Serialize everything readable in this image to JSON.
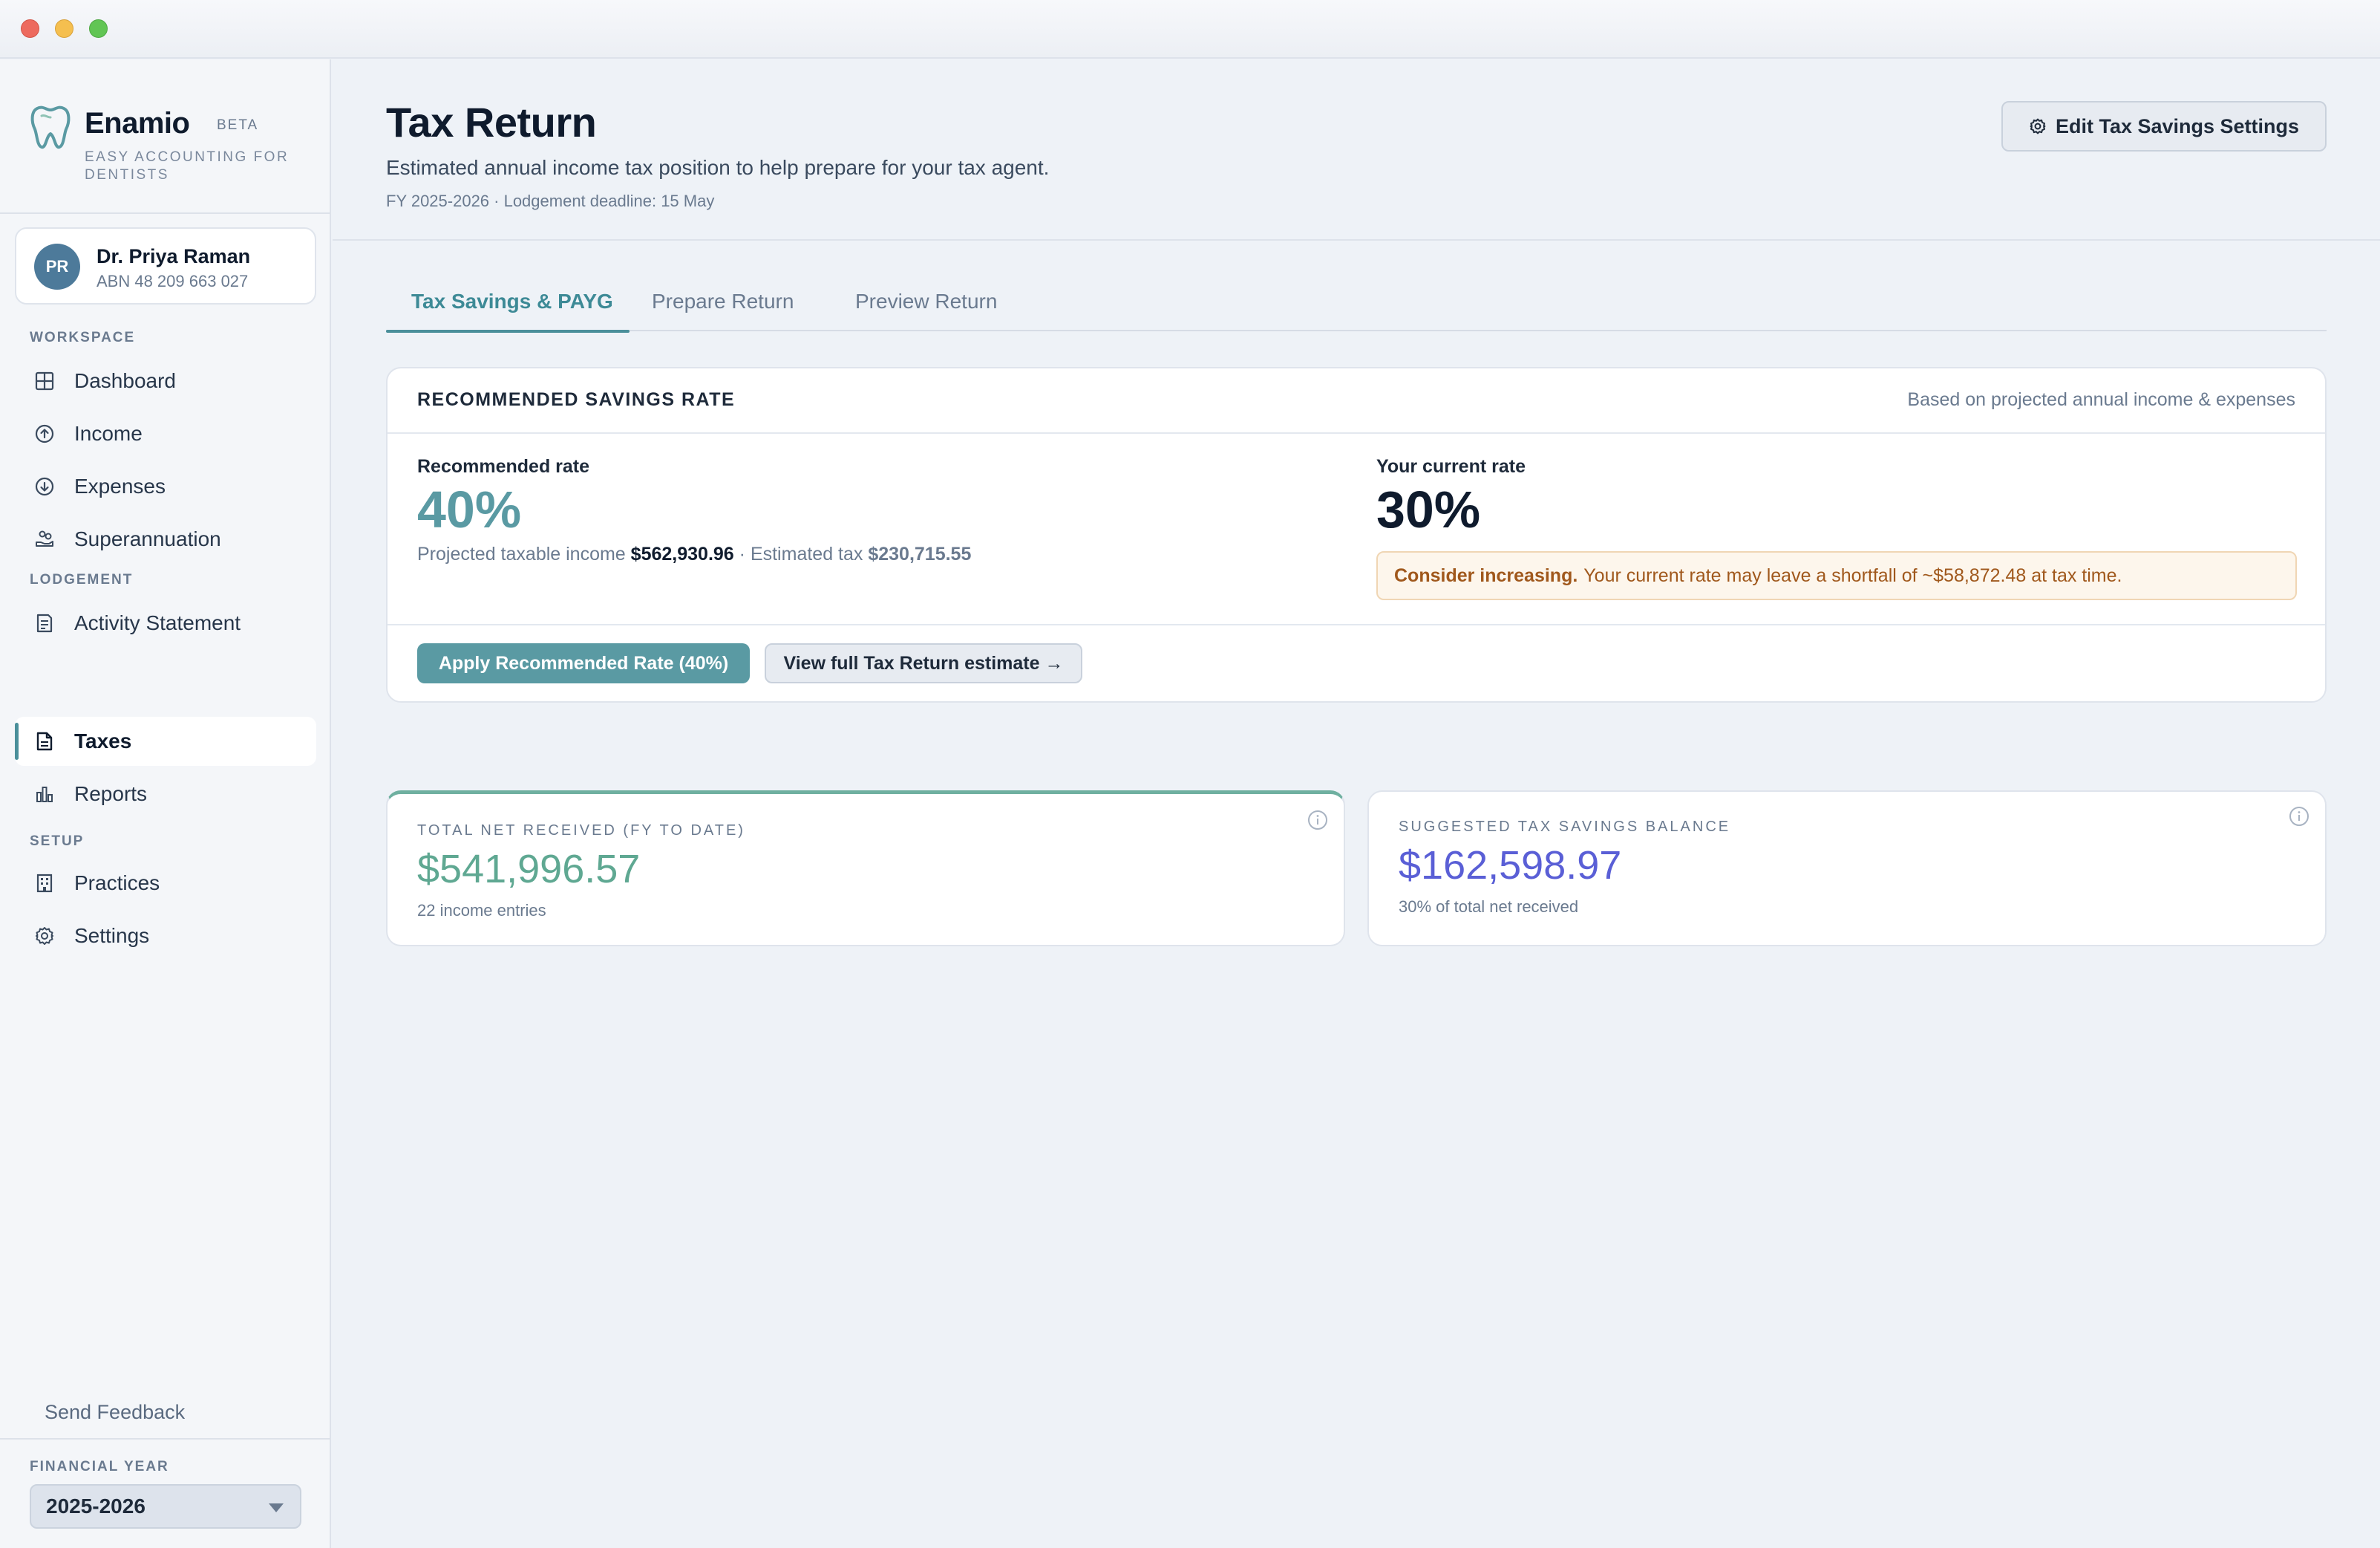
{
  "app": {
    "name": "Enamio",
    "badge": "BETA",
    "tagline": "EASY ACCOUNTING FOR DENTISTS"
  },
  "user": {
    "initials": "PR",
    "name": "Dr. Priya Raman",
    "abn": "ABN 48 209 663 027"
  },
  "sidebar": {
    "sections": [
      "WORKSPACE",
      "LODGEMENT",
      "SETUP"
    ],
    "items": [
      {
        "label": "Dashboard",
        "icon": "grid-icon"
      },
      {
        "label": "Income",
        "icon": "arrow-up-circle-icon"
      },
      {
        "label": "Expenses",
        "icon": "arrow-down-circle-icon"
      },
      {
        "label": "Superannuation",
        "icon": "hand-coins-icon"
      },
      {
        "label": "Activity Statement",
        "icon": "document-list-icon"
      },
      {
        "label": "Taxes",
        "icon": "document-icon",
        "active": true
      },
      {
        "label": "Reports",
        "icon": "bar-chart-icon"
      },
      {
        "label": "Practices",
        "icon": "building-icon"
      },
      {
        "label": "Settings",
        "icon": "gear-icon"
      }
    ],
    "feedback": "Send Feedback",
    "financial_year_label": "FINANCIAL YEAR",
    "financial_year_value": "2025-2026"
  },
  "header": {
    "title": "Tax Return",
    "subtitle": "Estimated annual income tax position to help prepare for your tax agent.",
    "meta": "FY 2025-2026 · Lodgement deadline: 15 May",
    "edit_button": "Edit Tax Savings Settings"
  },
  "tabs": [
    {
      "label": "Tax Savings & PAYG",
      "active": true
    },
    {
      "label": "Prepare Return",
      "active": false
    },
    {
      "label": "Preview Return",
      "active": false
    }
  ],
  "recommended": {
    "title": "RECOMMENDED SAVINGS RATE",
    "note": "Based on projected annual income & expenses",
    "rec_label": "Recommended rate",
    "rec_value": "40%",
    "projected_label": "Projected taxable income",
    "projected_value": "$562,930.96",
    "separator": "·",
    "estimated_label": "Estimated tax",
    "estimated_value": "$230,715.55",
    "current_label": "Your current rate",
    "current_value": "30%",
    "warn_strong": "Consider increasing.",
    "warn_text": "Your current rate may leave a shortfall of ~$58,872.48 at tax time.",
    "apply_button": "Apply Recommended Rate (40%)",
    "view_button": "View full Tax Return estimate →"
  },
  "stats": [
    {
      "label": "TOTAL NET RECEIVED (FY TO DATE)",
      "value": "$541,996.57",
      "sub": "22 income entries",
      "color": "#5fa892"
    },
    {
      "label": "SUGGESTED TAX SAVINGS BALANCE",
      "value": "$162,598.97",
      "sub": "30% of total net received",
      "color": "#5a5fd6"
    }
  ],
  "colors": {
    "accent": "#4a8f9a",
    "rec_value": "#5a9aa3",
    "warning": "#a0581c"
  }
}
